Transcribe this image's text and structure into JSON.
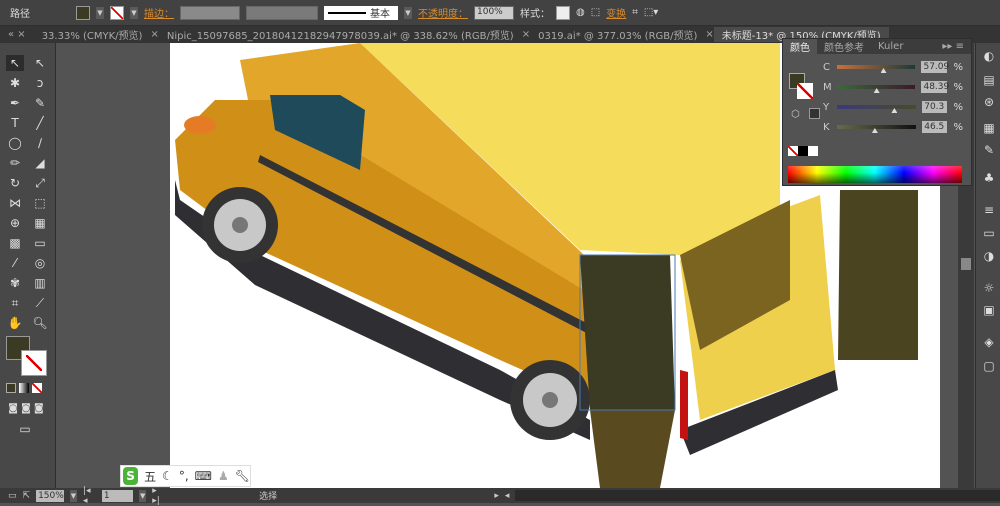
{
  "control_bar": {
    "object_type": "路径",
    "stroke_label": "描边：",
    "stroke_profile": "基本",
    "opacity_label": "不透明度：",
    "opacity_value": "100%",
    "style_label": "样式：",
    "transform_label": "变换"
  },
  "tabs": [
    {
      "label": "33.33% (CMYK/预览)"
    },
    {
      "label": "Nipic_15097685_20180412182947978039.ai* @ 338.62% (RGB/预览)"
    },
    {
      "label": "0319.ai* @ 377.03% (RGB/预览)"
    },
    {
      "label": "未标题-13* @ 150% (CMYK/预览)",
      "active": true
    }
  ],
  "color_panel": {
    "tabs": [
      "颜色",
      "颜色参考",
      "Kuler"
    ],
    "fill_color": "#3b3a22",
    "channels": [
      {
        "key": "C",
        "value": "57.09",
        "percent": 57.09,
        "grad": [
          "#c8703a",
          "#1a3a3a"
        ]
      },
      {
        "key": "M",
        "value": "48.39",
        "percent": 48.39,
        "grad": [
          "#3a6a3a",
          "#3a1a2a"
        ]
      },
      {
        "key": "Y",
        "value": "70.3",
        "percent": 70.3,
        "grad": [
          "#3a3a7a",
          "#4a4a2a"
        ]
      },
      {
        "key": "K",
        "value": "46.5",
        "percent": 46.5,
        "grad": [
          "#6a6a4a",
          "#111111"
        ]
      }
    ],
    "unit": "%"
  },
  "status_bar": {
    "zoom": "150%",
    "page": "1",
    "tool": "选择"
  },
  "ime_toolbar": {
    "logo": "S",
    "mode": "五"
  }
}
